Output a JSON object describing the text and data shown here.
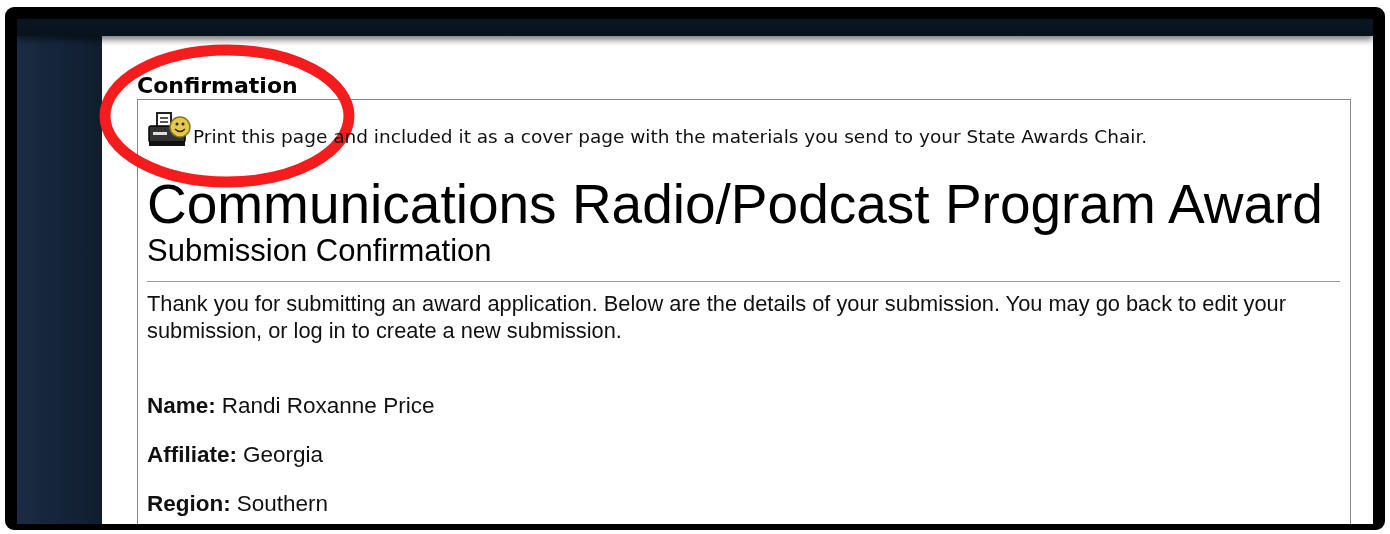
{
  "section_heading": "Confirmation",
  "print_note": "Print this page and included it as a cover page with the materials you send to your State Awards Chair.",
  "title": "Communications Radio/Podcast Program Award",
  "subtitle": "Submission Confirmation",
  "intro": "Thank you for submitting an award application. Below are the details of your submission. You may go back to edit your submission, or log in to create a new submission.",
  "fields": [
    {
      "label": "Name:",
      "value": "Randi Roxanne Price"
    },
    {
      "label": "Affiliate:",
      "value": "Georgia"
    },
    {
      "label": "Region:",
      "value": "Southern"
    }
  ]
}
